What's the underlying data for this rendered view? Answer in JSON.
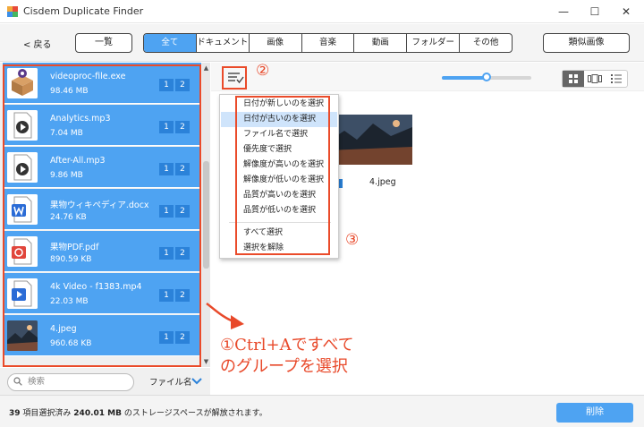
{
  "window": {
    "title": "Cisdem Duplicate Finder",
    "minimize": "—",
    "maximize": "☐",
    "close": "✕"
  },
  "toolbar": {
    "back": "< 戻る",
    "overview": "一覧",
    "tabs": [
      "全て",
      "ドキュメント",
      "画像",
      "音楽",
      "動画",
      "フォルダー",
      "その他"
    ],
    "similar": "類似画像"
  },
  "files": [
    {
      "name": "videoproc-file.exe",
      "size": "98.46 MB",
      "icon": "package-box-icon",
      "badges": [
        "1",
        "2"
      ]
    },
    {
      "name": "Analytics.mp3",
      "size": "7.04 MB",
      "icon": "play-file-icon",
      "badges": [
        "1",
        "2"
      ]
    },
    {
      "name": "After-All.mp3",
      "size": "9.86 MB",
      "icon": "play-file-icon",
      "badges": [
        "1",
        "2"
      ]
    },
    {
      "name": "果物ウィキペディア.docx",
      "size": "24.76 KB",
      "icon": "word-doc-icon",
      "badges": [
        "1",
        "2"
      ]
    },
    {
      "name": "果物PDF.pdf",
      "size": "890.59 KB",
      "icon": "pdf-icon",
      "badges": [
        "1",
        "2"
      ]
    },
    {
      "name": "4k Video - f1383.mp4",
      "size": "22.03 MB",
      "icon": "video-file-icon",
      "badges": [
        "1",
        "2"
      ]
    },
    {
      "name": "4.jpeg",
      "size": "960.68 KB",
      "icon": "image-thumb-icon",
      "badges": [
        "1",
        "2"
      ]
    }
  ],
  "search": {
    "placeholder": "検索",
    "sort": "ファイル名"
  },
  "preview": {
    "filename": "4.jpeg"
  },
  "slider_value": 0.5,
  "menu": {
    "items": [
      "日付が新しいのを選択",
      "日付が古いのを選択",
      "ファイル名で選択",
      "優先度で選択",
      "解像度が高いのを選択",
      "解像度が低いのを選択",
      "品質が高いのを選択",
      "品質が低いのを選択"
    ],
    "items2": [
      "すべて選択",
      "選択を解除"
    ],
    "highlighted_index": 1
  },
  "annotations": {
    "circle2": "②",
    "circle3": "③",
    "line1": "①Ctrl+Aですべて",
    "line2": "のグループを選択"
  },
  "status": {
    "count": "39",
    "count_label": "項目選択済み",
    "size": "240.01 MB",
    "size_label": "のストレージスペースが解放されます。"
  },
  "delete_label": "削除",
  "colors": {
    "accent": "#4ea3f2",
    "annotation": "#e8492a"
  }
}
